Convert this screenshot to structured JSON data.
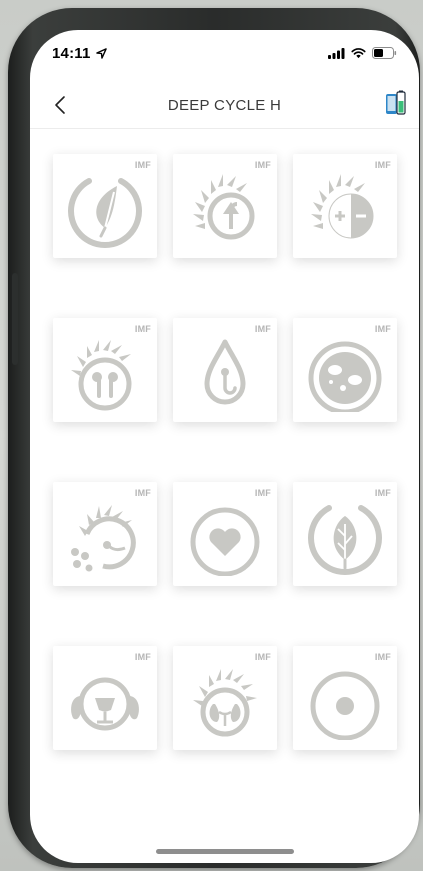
{
  "status_bar": {
    "time": "14:11",
    "location_icon": "location-arrow-icon",
    "signal_icon": "cellular-signal-icon",
    "wifi_icon": "wifi-icon",
    "battery_icon": "battery-icon"
  },
  "header": {
    "title": "DEEP CYCLE H",
    "back_icon": "chevron-left-icon",
    "mode_icon": "phone-battery-icon"
  },
  "colors": {
    "icon_gray": "#c8c8c4",
    "badge_gray": "#b5b5b5",
    "accent_green": "#3bbf7a",
    "accent_blue": "#2e86c8"
  },
  "programs": [
    {
      "badge": "IMF",
      "icon": "feather-icon"
    },
    {
      "badge": "IMF",
      "icon": "sun-arrow-icon"
    },
    {
      "badge": "IMF",
      "icon": "sun-plus-minus-icon"
    },
    {
      "badge": "IMF",
      "icon": "sun-ovary-icon"
    },
    {
      "badge": "IMF",
      "icon": "drop-icon"
    },
    {
      "badge": "IMF",
      "icon": "cells-icon"
    },
    {
      "badge": "IMF",
      "icon": "sun-sperm-icon"
    },
    {
      "badge": "IMF",
      "icon": "heart-icon"
    },
    {
      "badge": "IMF",
      "icon": "leaf-icon"
    },
    {
      "badge": "IMF",
      "icon": "face-icon"
    },
    {
      "badge": "IMF",
      "icon": "sun-kidney-icon"
    },
    {
      "badge": "IMF",
      "icon": "dot-circle-icon"
    }
  ]
}
